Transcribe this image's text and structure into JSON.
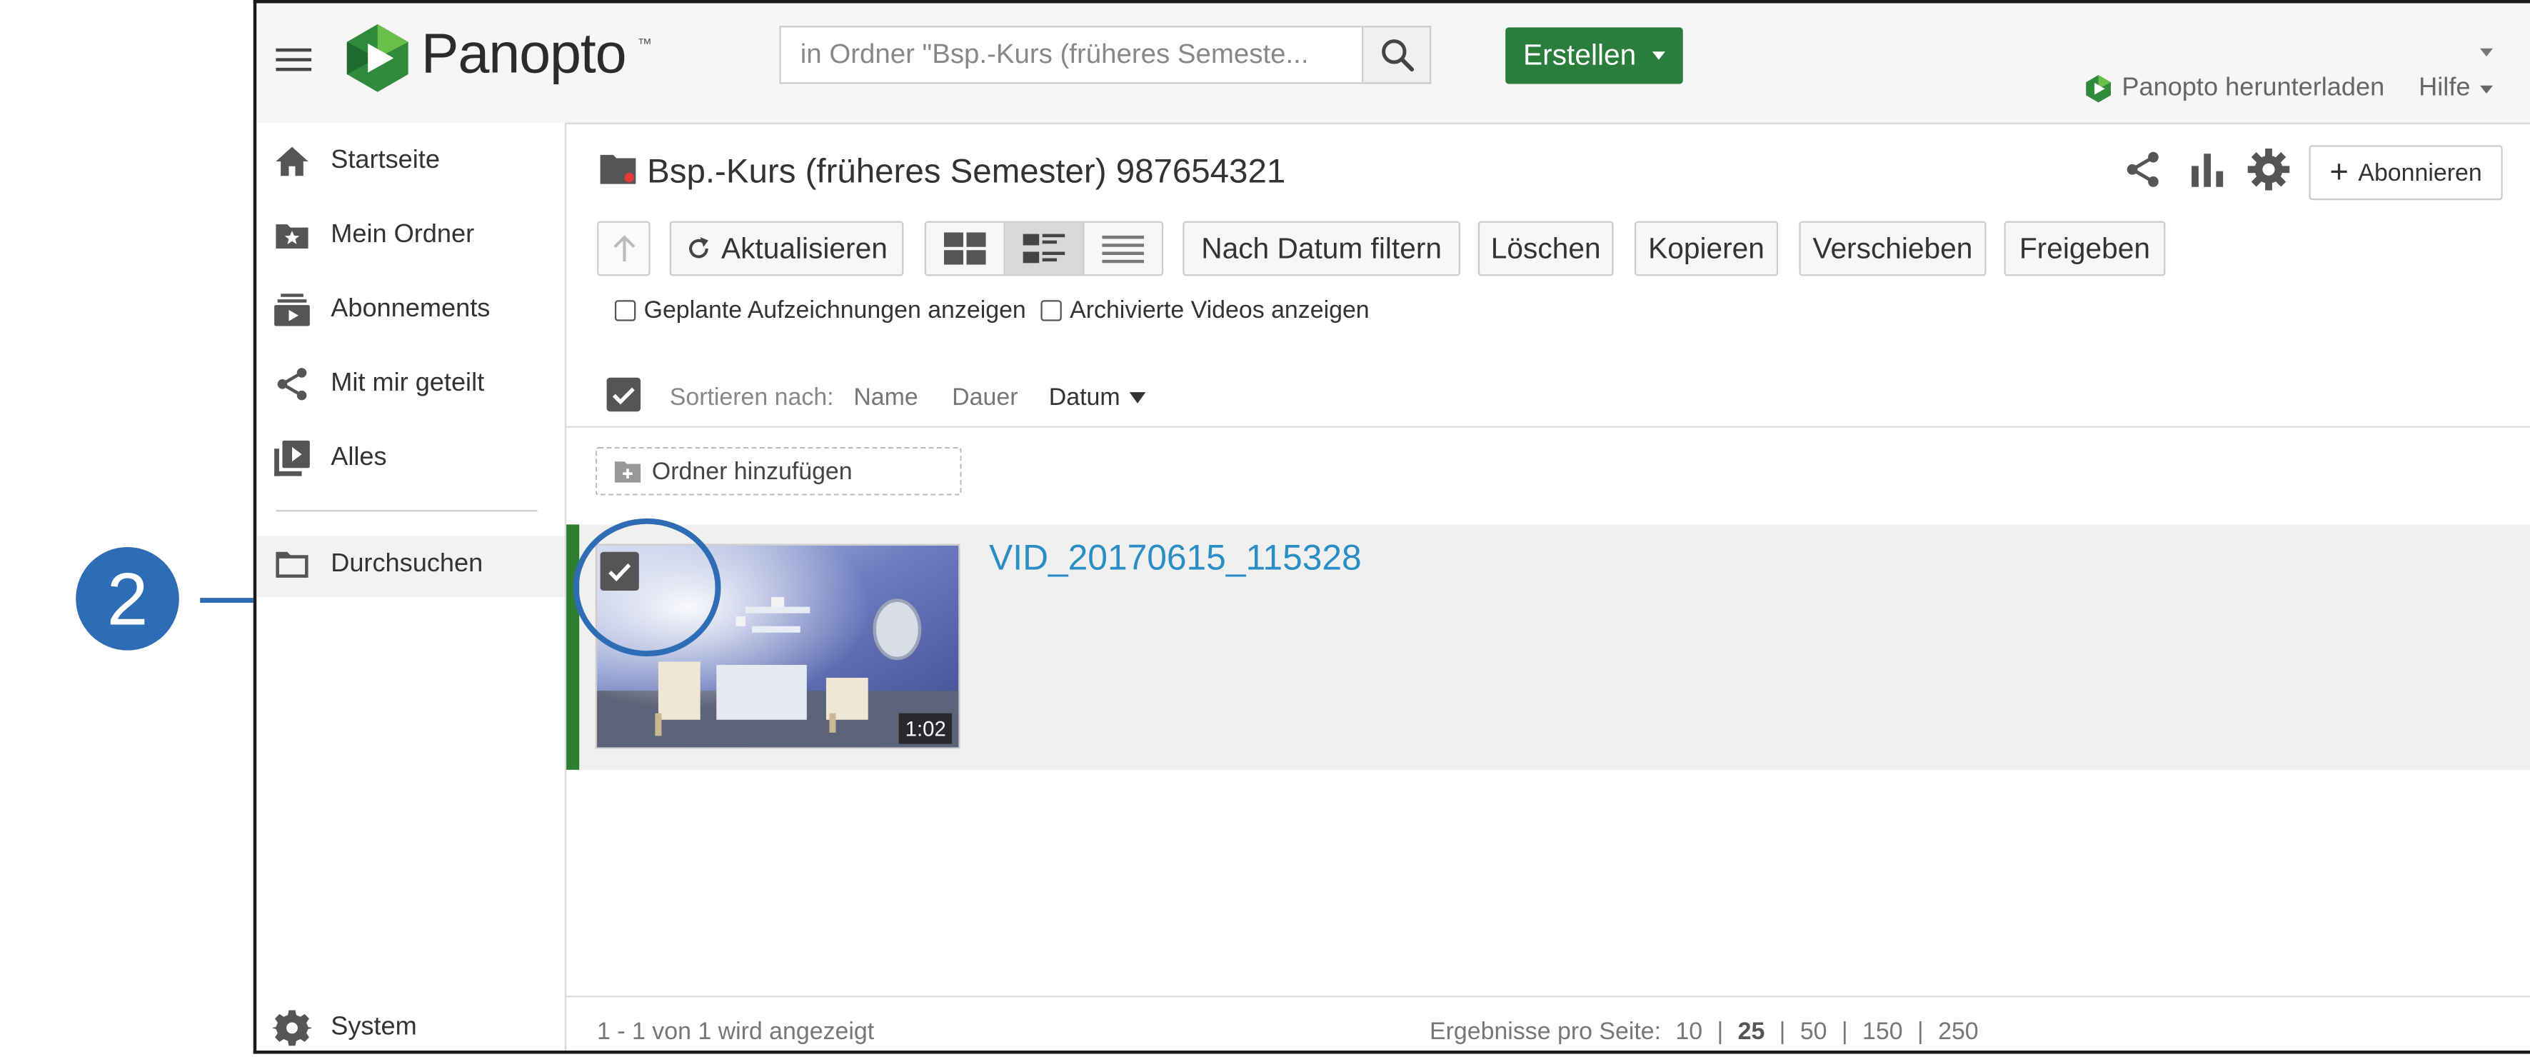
{
  "header": {
    "logo_text": "Panopto",
    "logo_tm": "™",
    "search_placeholder": "in Ordner \"Bsp.-Kurs (früheres Semeste...",
    "create_label": "Erstellen",
    "download_label": "Panopto herunterladen",
    "help_label": "Hilfe"
  },
  "sidebar": {
    "items": [
      {
        "label": "Startseite",
        "icon": "home-icon"
      },
      {
        "label": "Mein Ordner",
        "icon": "my-folder-icon"
      },
      {
        "label": "Abonnements",
        "icon": "subscriptions-icon"
      },
      {
        "label": "Mit mir geteilt",
        "icon": "share-icon"
      },
      {
        "label": "Alles",
        "icon": "library-icon"
      }
    ],
    "browse_label": "Durchsuchen",
    "system_label": "System"
  },
  "main": {
    "folder_title": "Bsp.-Kurs (früheres Semester) 987654321",
    "subscribe_label": "Abonnieren",
    "toolbar": {
      "refresh": "Aktualisieren",
      "filter_date": "Nach Datum filtern",
      "delete": "Löschen",
      "copy": "Kopieren",
      "move": "Verschieben",
      "share": "Freigeben"
    },
    "options": {
      "scheduled": "Geplante Aufzeichnungen anzeigen",
      "archived": "Archivierte Videos anzeigen"
    },
    "sort": {
      "label": "Sortieren nach:",
      "name": "Name",
      "duration": "Dauer",
      "date": "Datum"
    },
    "add_folder": "Ordner hinzufügen",
    "video": {
      "title": "VID_20170615_115328",
      "duration": "1:02"
    },
    "footer": {
      "count_text": "1 - 1 von 1 wird angezeigt",
      "per_page_label": "Ergebnisse pro Seite:",
      "options": [
        "10",
        "25",
        "50",
        "150",
        "250"
      ],
      "selected": "25",
      "separator": "|"
    }
  },
  "annotation": {
    "step_number": "2",
    "color": "#2e6db5"
  },
  "colors": {
    "accent_green": "#2a7d3a",
    "link_blue": "#2a8dc5"
  }
}
